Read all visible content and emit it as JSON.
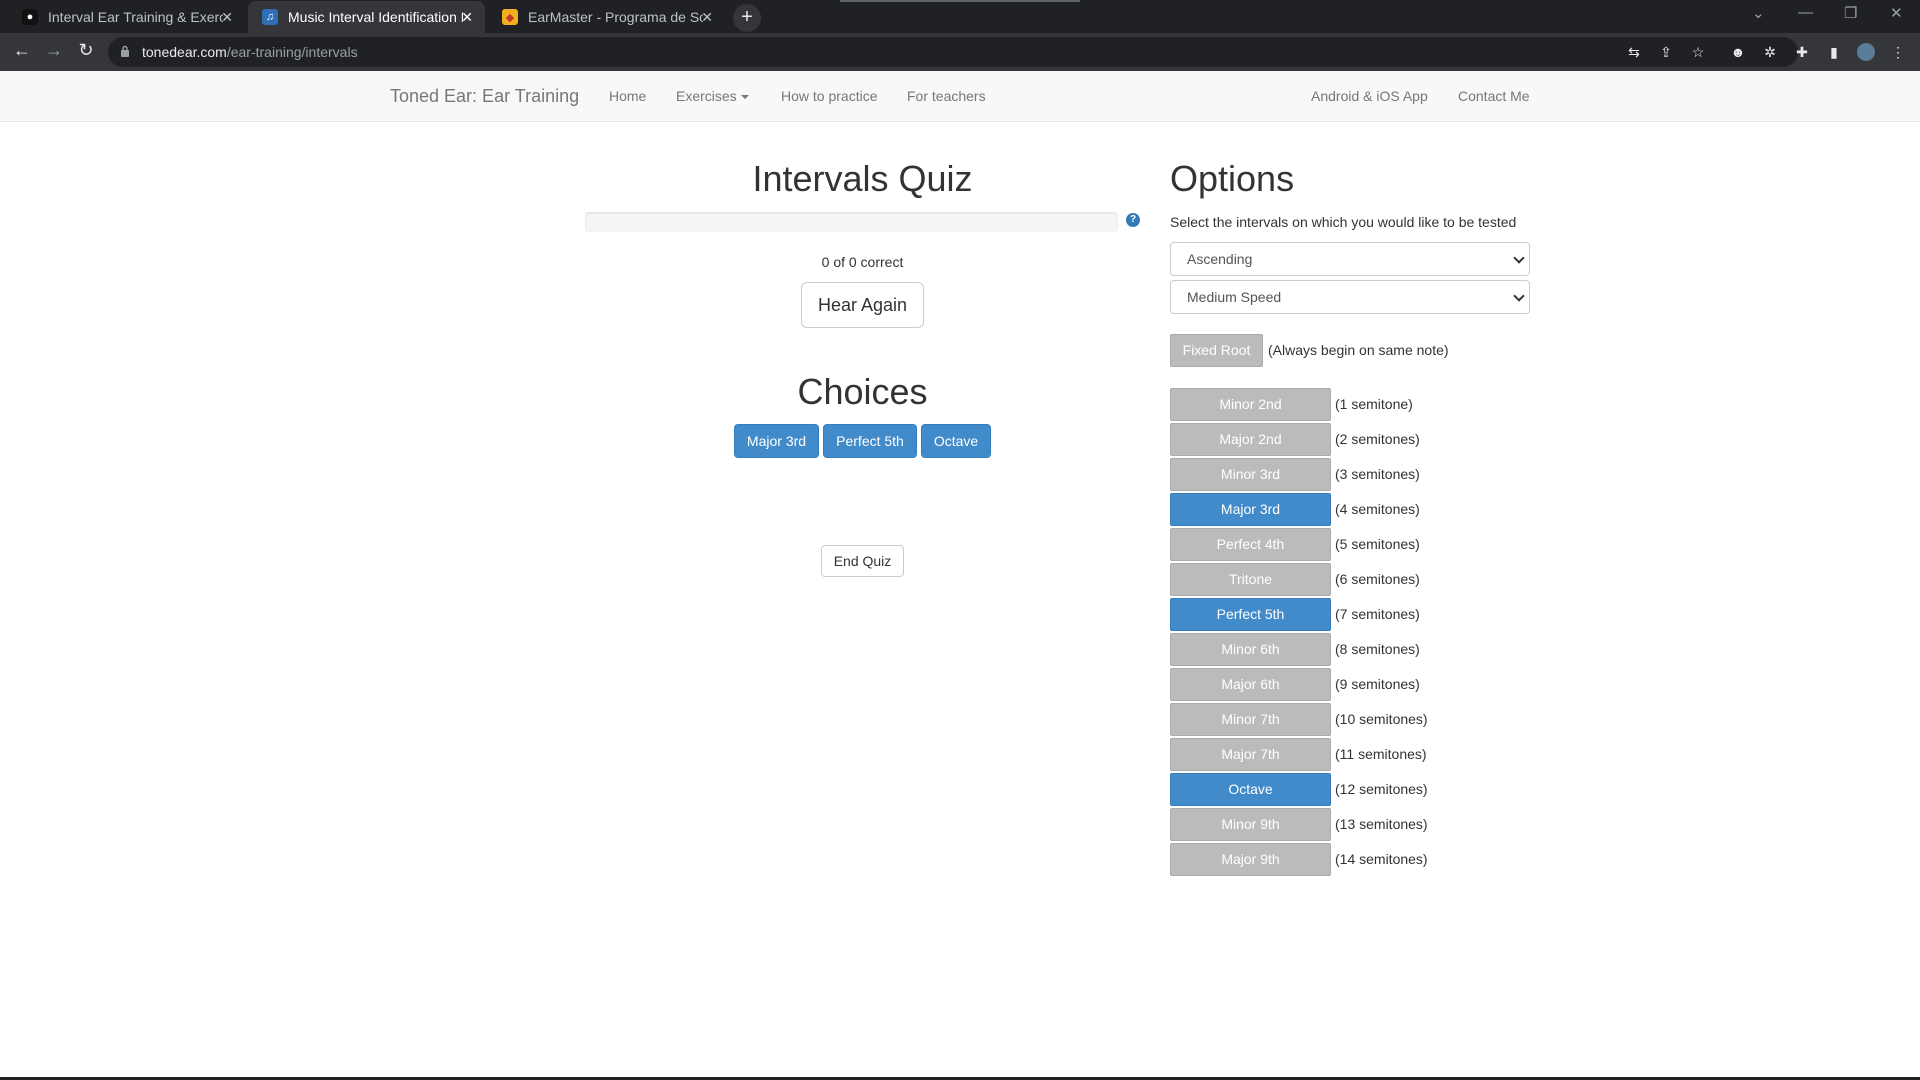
{
  "browser": {
    "tabs": [
      {
        "title": "Interval Ear Training & Exercises",
        "active": false
      },
      {
        "title": "Music Interval Identification Ear T",
        "active": true
      },
      {
        "title": "EarMaster - Programa de Solfeo",
        "active": false
      }
    ],
    "url_host": "tonedear.com",
    "url_path": "/ear-training/intervals"
  },
  "navbar": {
    "brand": "Toned Ear: Ear Training",
    "links": [
      "Home",
      "Exercises",
      "How to practice",
      "For teachers"
    ],
    "right_links": [
      "Android & iOS App",
      "Contact Me"
    ]
  },
  "quiz": {
    "title": "Intervals Quiz",
    "help_icon": "?",
    "score": "0 of 0 correct",
    "hear_again": "Hear Again",
    "choices_title": "Choices",
    "choices": [
      "Major 3rd",
      "Perfect 5th",
      "Octave"
    ],
    "end_quiz": "End Quiz"
  },
  "options": {
    "title": "Options",
    "description": "Select the intervals on which you would like to be tested",
    "direction": "Ascending",
    "speed": "Medium Speed",
    "fixed_root": {
      "label": "Fixed Root",
      "note": "(Always begin on same note)",
      "on": false
    },
    "intervals": [
      {
        "label": "Minor 2nd",
        "note": "(1 semitone)",
        "on": false
      },
      {
        "label": "Major 2nd",
        "note": "(2 semitones)",
        "on": false
      },
      {
        "label": "Minor 3rd",
        "note": "(3 semitones)",
        "on": false
      },
      {
        "label": "Major 3rd",
        "note": "(4 semitones)",
        "on": true
      },
      {
        "label": "Perfect 4th",
        "note": "(5 semitones)",
        "on": false
      },
      {
        "label": "Tritone",
        "note": "(6 semitones)",
        "on": false
      },
      {
        "label": "Perfect 5th",
        "note": "(7 semitones)",
        "on": true
      },
      {
        "label": "Minor 6th",
        "note": "(8 semitones)",
        "on": false
      },
      {
        "label": "Major 6th",
        "note": "(9 semitones)",
        "on": false
      },
      {
        "label": "Minor 7th",
        "note": "(10 semitones)",
        "on": false
      },
      {
        "label": "Major 7th",
        "note": "(11 semitones)",
        "on": false
      },
      {
        "label": "Octave",
        "note": "(12 semitones)",
        "on": true
      },
      {
        "label": "Minor 9th",
        "note": "(13 semitones)",
        "on": false
      },
      {
        "label": "Major 9th",
        "note": "(14 semitones)",
        "on": false
      }
    ]
  },
  "colors": {
    "accent": "#428bca",
    "toggle_off": "#bbbbbb"
  }
}
